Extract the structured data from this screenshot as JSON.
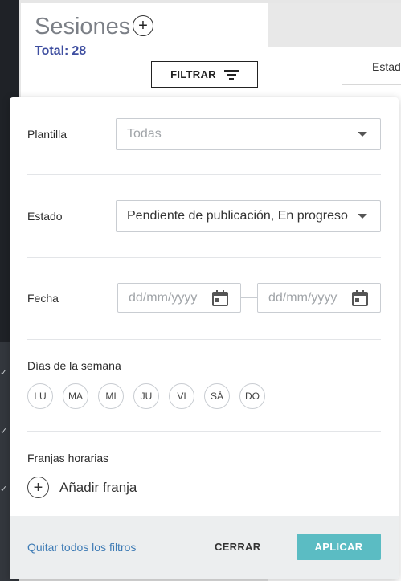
{
  "header": {
    "title": "Sesiones",
    "add_icon": "+",
    "total_label": "Total:",
    "total_value": "28",
    "filter_button": "FILTRAR"
  },
  "table": {
    "column_header_partial": "Estad"
  },
  "filters": {
    "template": {
      "label": "Plantilla",
      "value": "Todas"
    },
    "status": {
      "label": "Estado",
      "value": "Pendiente de publicación, En progreso"
    },
    "date": {
      "label": "Fecha",
      "from_placeholder": "dd/mm/yyyy",
      "to_placeholder": "dd/mm/yyyy"
    },
    "weekdays": {
      "label": "Días de la semana",
      "days": [
        "LU",
        "MA",
        "MI",
        "JU",
        "VI",
        "SÁ",
        "DO"
      ]
    },
    "time_slots": {
      "label": "Franjas horarias",
      "add_label": "Añadir franja"
    }
  },
  "footer": {
    "clear_all": "Quitar todos los filtros",
    "close": "CERRAR",
    "apply": "APLICAR"
  },
  "colors": {
    "accent": "#5bbcc3",
    "total": "#3e4ea0",
    "link": "#3e7bb5"
  },
  "icons": {
    "filter": "filter-lines-icon",
    "calendar": "calendar-icon",
    "dropdown": "chevron-down-icon",
    "add": "plus-circle-icon"
  }
}
